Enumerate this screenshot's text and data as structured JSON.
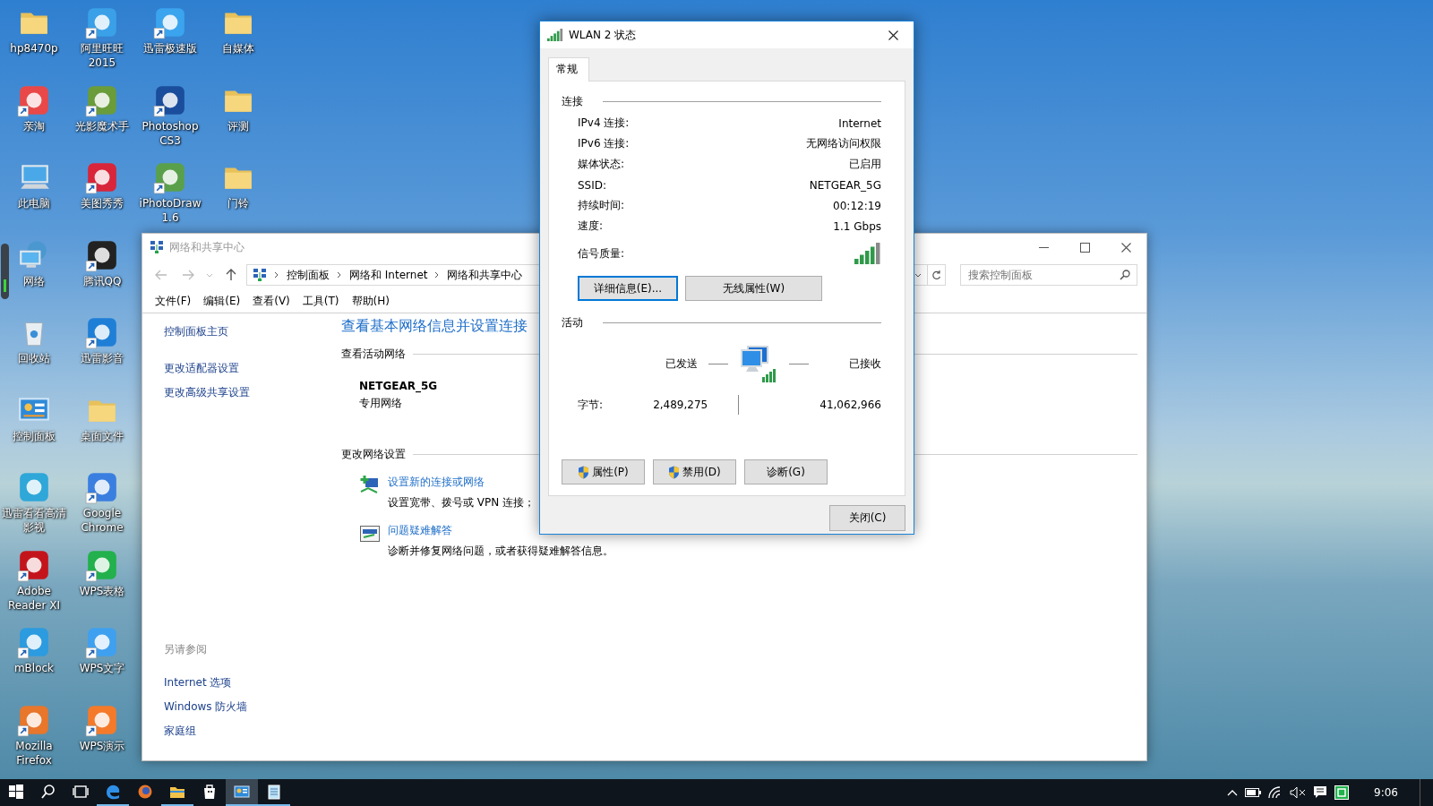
{
  "desktop_icon_columns": [
    {
      "icons": [
        {
          "label": "hp8470p",
          "kind": "folder",
          "shortcut": false
        },
        {
          "label": "亲淘",
          "kind": "app",
          "color": "#e94848",
          "shortcut": true
        },
        {
          "label": "此电脑",
          "kind": "computer",
          "shortcut": false
        },
        {
          "label": "网络",
          "kind": "network",
          "shortcut": false
        },
        {
          "label": "回收站",
          "kind": "recycle-bin",
          "shortcut": false
        },
        {
          "label": "控制面板",
          "kind": "control-panel",
          "shortcut": false
        },
        {
          "label": "迅雷看看高清影视",
          "kind": "app",
          "color": "#2fa7d8",
          "shortcut": false
        },
        {
          "label": "Adobe Reader XI",
          "kind": "app",
          "color": "#c4141b",
          "shortcut": true
        },
        {
          "label": "mBlock",
          "kind": "app",
          "color": "#2c9be0",
          "shortcut": true
        },
        {
          "label": "Mozilla Firefox",
          "kind": "app",
          "color": "#e8762b",
          "shortcut": true
        }
      ]
    },
    {
      "icons": [
        {
          "label": "阿里旺旺 2015",
          "kind": "app",
          "color": "#3aa0e8",
          "shortcut": true
        },
        {
          "label": "光影魔术手",
          "kind": "app",
          "color": "#6a9c3a",
          "shortcut": true
        },
        {
          "label": "美图秀秀",
          "kind": "app",
          "color": "#d8253a",
          "shortcut": true
        },
        {
          "label": "腾讯QQ",
          "kind": "app",
          "color": "#222222",
          "shortcut": true
        },
        {
          "label": "迅雷影音",
          "kind": "app",
          "color": "#1f7fd6",
          "shortcut": true
        },
        {
          "label": "桌面文件",
          "kind": "folder",
          "shortcut": false
        },
        {
          "label": "Google Chrome",
          "kind": "app",
          "color": "#3a7fe0",
          "shortcut": true
        },
        {
          "label": "WPS表格",
          "kind": "app",
          "color": "#22b14c",
          "shortcut": true
        },
        {
          "label": "WPS文字",
          "kind": "app",
          "color": "#3fa0f0",
          "shortcut": true
        },
        {
          "label": "WPS演示",
          "kind": "app",
          "color": "#f47a2a",
          "shortcut": true
        }
      ]
    },
    {
      "icons": [
        {
          "label": "迅雷极速版",
          "kind": "app",
          "color": "#3ba4ee",
          "shortcut": true
        },
        {
          "label": "Photoshop CS3",
          "kind": "app",
          "color": "#1a4d9c",
          "shortcut": true
        },
        {
          "label": "iPhotoDraw 1.6",
          "kind": "app",
          "color": "#5aa04a",
          "shortcut": true
        }
      ]
    },
    {
      "icons": [
        {
          "label": "自媒体",
          "kind": "folder",
          "shortcut": false
        },
        {
          "label": "评测",
          "kind": "folder",
          "shortcut": false
        },
        {
          "label": "门铃",
          "kind": "folder",
          "shortcut": false
        }
      ]
    }
  ],
  "network_center_window": {
    "title": "网络和共享中心",
    "breadcrumbs": [
      "控制面板",
      "网络和 Internet",
      "网络和共享中心"
    ],
    "search": {
      "placeholder": "搜索控制面板"
    },
    "menu": [
      "文件(F)",
      "编辑(E)",
      "查看(V)",
      "工具(T)",
      "帮助(H)"
    ],
    "sidebar": {
      "links": [
        "控制面板主页",
        "更改适配器设置",
        "更改高级共享设置"
      ],
      "see_also_title": "另请参阅",
      "see_also": [
        "Internet 选项",
        "Windows 防火墙",
        "家庭组"
      ]
    },
    "heading": "查看基本网络信息并设置连接",
    "active_networks_title": "查看活动网络",
    "network_name": "NETGEAR_5G",
    "network_type": "专用网络",
    "change_settings_title": "更改网络设置",
    "tasks": [
      {
        "kind": "new-connection",
        "link": "设置新的连接或网络",
        "description": "设置宽带、拨号或 VPN 连接；"
      },
      {
        "kind": "troubleshoot",
        "link": "问题疑难解答",
        "description": "诊断并修复网络问题，或者获得疑难解答信息。"
      }
    ]
  },
  "status_dialog": {
    "title": "WLAN 2 状态",
    "tabs": [
      {
        "label": "常规",
        "selected": true
      }
    ],
    "connection_title": "连接",
    "connection_rows": [
      {
        "kind": "text",
        "label": "IPv4 连接:",
        "value": "Internet"
      },
      {
        "kind": "text",
        "label": "IPv6 连接:",
        "value": "无网络访问权限"
      },
      {
        "kind": "text",
        "label": "媒体状态:",
        "value": "已启用"
      },
      {
        "kind": "text",
        "label": "SSID:",
        "value": "NETGEAR_5G"
      },
      {
        "kind": "text",
        "label": "持续时间:",
        "value": "00:12:19"
      },
      {
        "kind": "text",
        "label": "速度:",
        "value": "1.1 Gbps"
      },
      {
        "kind": "signal",
        "label": "信号质量:"
      }
    ],
    "buttons": [
      {
        "label": "详细信息(E)...",
        "focused": true
      },
      {
        "label": "无线属性(W)",
        "focused": false
      }
    ],
    "activity_title": "活动",
    "sent_label": "已发送",
    "received_label": "已接收",
    "bytes_label": "字节:",
    "bytes_sent": "2,489,275",
    "bytes_received": "41,062,966",
    "action_buttons": [
      {
        "label": "属性(P)",
        "shield": true
      },
      {
        "label": "禁用(D)",
        "shield": true
      },
      {
        "label": "诊断(G)",
        "shield": false
      }
    ],
    "close_button": "关闭(C)"
  },
  "taskbar": {
    "apps": [
      {
        "kind": "start",
        "running": false,
        "selected": false
      },
      {
        "kind": "search",
        "running": false,
        "selected": false
      },
      {
        "kind": "task-view",
        "running": false,
        "selected": false
      },
      {
        "kind": "edge",
        "running": true,
        "selected": false
      },
      {
        "kind": "firefox",
        "running": false,
        "selected": false
      },
      {
        "kind": "explorer",
        "running": true,
        "selected": false
      },
      {
        "kind": "store",
        "running": false,
        "selected": false
      },
      {
        "kind": "control-panel",
        "running": true,
        "selected": true
      },
      {
        "kind": "notepad",
        "running": true,
        "selected": false
      }
    ],
    "clock": "9:06"
  }
}
